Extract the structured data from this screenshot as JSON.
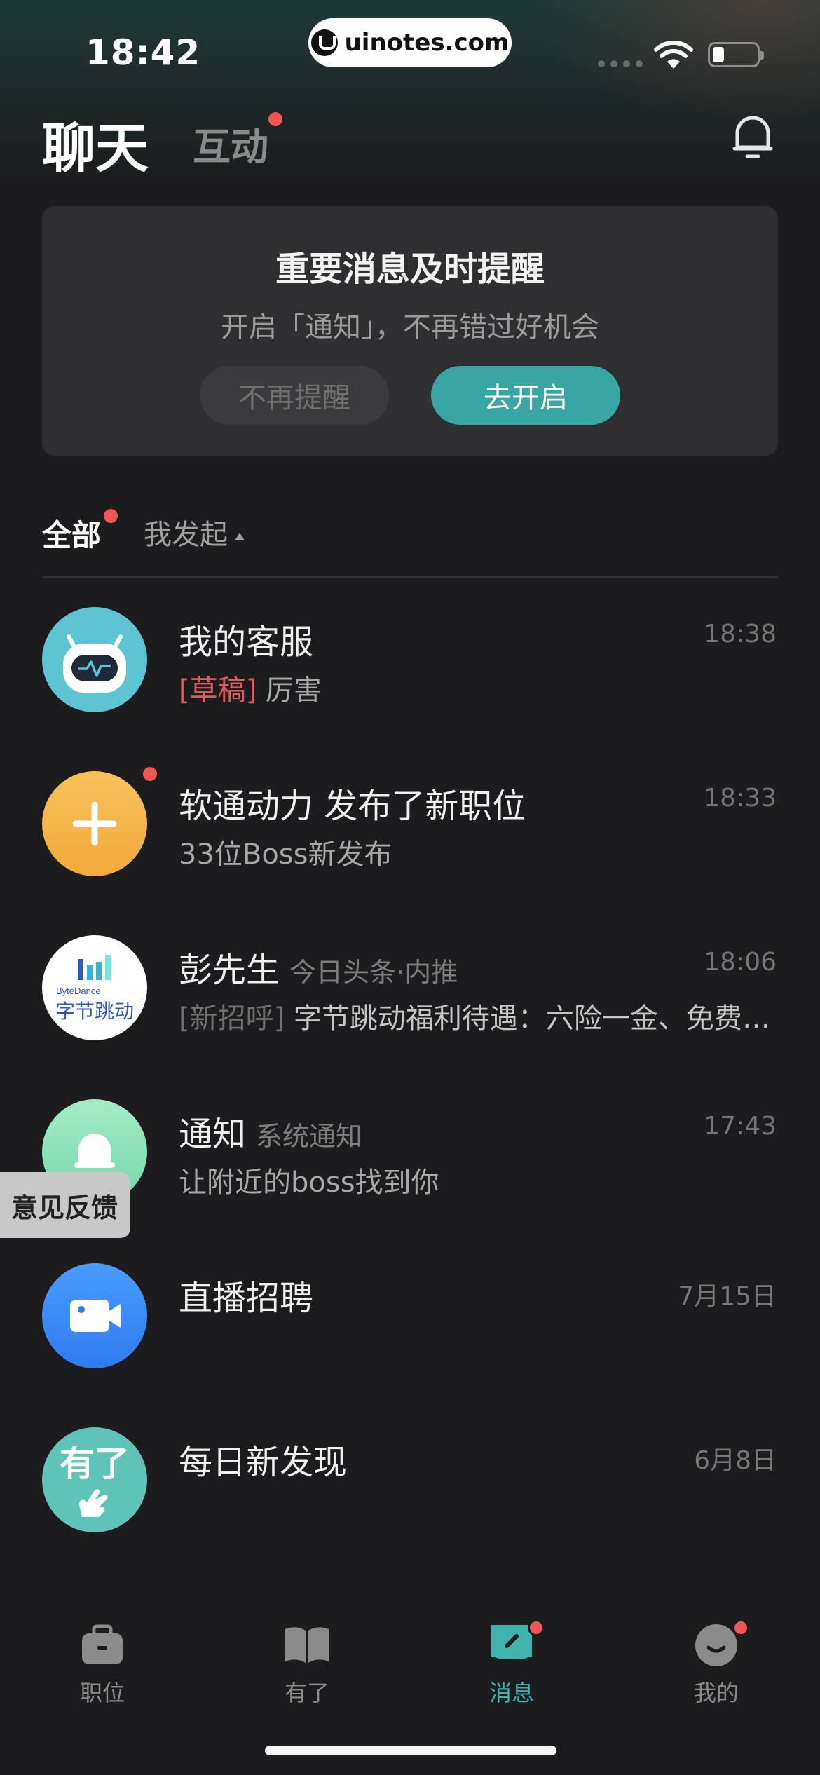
{
  "status_bar": {
    "time": "18:42",
    "site": "uinotes.com"
  },
  "header": {
    "tab_chat": "聊天",
    "tab_interact": "互动"
  },
  "notice": {
    "title": "重要消息及时提醒",
    "subtitle": "开启「通知」，不再错过好机会",
    "dismiss_label": "不再提醒",
    "enable_label": "去开启"
  },
  "filter": {
    "all_label": "全部",
    "mine_label": "我发起"
  },
  "chats": [
    {
      "name": "我的客服",
      "tag": "",
      "time": "18:38",
      "prefix": "[草稿]",
      "message": " 厉害"
    },
    {
      "name": "软通动力 发布了新职位",
      "tag": "",
      "time": "18:33",
      "prefix": "",
      "message": "33位Boss新发布"
    },
    {
      "name": "彭先生",
      "tag": "今日头条·内推",
      "time": "18:06",
      "prefix": "[新招呼]",
      "message": " 字节跳动福利待遇：六险一金、免费三餐、下午茶、租房补贴"
    },
    {
      "name": "通知",
      "tag": "系统通知",
      "time": "17:43",
      "prefix": "",
      "message": "让附近的boss找到你"
    },
    {
      "name": "直播招聘",
      "tag": "",
      "time": "7月15日",
      "prefix": "",
      "message": ""
    },
    {
      "name": "每日新发现",
      "tag": "",
      "time": "6月8日",
      "prefix": "",
      "message": ""
    }
  ],
  "avatars": {
    "bytedance_en": "ByteDance",
    "bytedance_cn": "字节跳动",
    "youle": "有了"
  },
  "feedback_label": "意见反馈",
  "bottom_nav": [
    {
      "label": "职位",
      "icon": "briefcase-icon"
    },
    {
      "label": "有了",
      "icon": "book-icon"
    },
    {
      "label": "消息",
      "icon": "message-icon"
    },
    {
      "label": "我的",
      "icon": "smiley-icon"
    }
  ],
  "colors": {
    "accent": "#3aa6a3",
    "badge": "#f05656",
    "background": "#1c1c1e"
  }
}
